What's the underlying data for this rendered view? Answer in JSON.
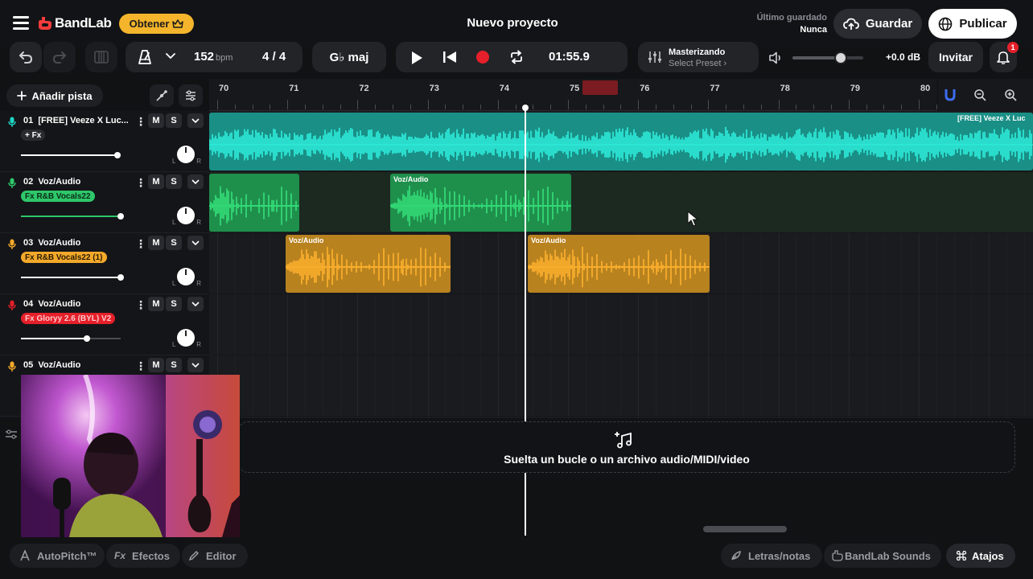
{
  "app": {
    "brand": "BandLab",
    "get_label": "Obtener",
    "project_title": "Nuevo proyecto",
    "last_saved_label": "Último guardado",
    "last_saved_value": "Nunca",
    "save_label": "Guardar",
    "publish_label": "Publicar",
    "accent_color": "#f4b52c"
  },
  "transport": {
    "bpm": "152",
    "bpm_unit": "bpm",
    "time_signature": "4 / 4",
    "key": "G♭ maj",
    "time": "01:55.9",
    "mastering_title": "Masterizando",
    "mastering_preset": "Select Preset ›",
    "master_volume_fraction": 0.68,
    "master_db": "+0.0 dB",
    "invite_label": "Invitar",
    "notification_count": "1"
  },
  "toolbar": {
    "add_track_label": "Añadir pista"
  },
  "ruler": {
    "bars": [
      "70",
      "71",
      "72",
      "73",
      "74",
      "75",
      "76",
      "77",
      "78",
      "79",
      "80"
    ]
  },
  "tracks": [
    {
      "number": "01",
      "name": "[FREE] Veeze X Luc...",
      "fx": "+ Fx",
      "color": "#1ed7c4",
      "volume": 0.97,
      "fx_bg": "#2a2b30",
      "fx_fg": "#ffffff"
    },
    {
      "number": "02",
      "name": "Voz/Audio",
      "fx": "Fx R&B Vocals22",
      "color": "#2ec76a",
      "volume": 1.0,
      "fx_bg": "#2ec76a",
      "fx_fg": "#0c2a17"
    },
    {
      "number": "03",
      "name": "Voz/Audio",
      "fx": "Fx R&B Vocals22 (1)",
      "color": "#f3a92a",
      "volume": 1.0,
      "fx_bg": "#f3a92a",
      "fx_fg": "#2a1c05"
    },
    {
      "number": "04",
      "name": "Voz/Audio",
      "fx": "Fx Gloryy 2.6 (BYL) V2",
      "color": "#e5202a",
      "volume": 0.66,
      "fx_bg": "#e5202a",
      "fx_fg": "#ffc9cc"
    },
    {
      "number": "05",
      "name": "Voz/Audio",
      "fx": "",
      "color": "#f3a92a",
      "volume": 0.0,
      "fx_bg": "#2a2b30",
      "fx_fg": "#ffffff"
    }
  ],
  "track_buttons": {
    "mute": "M",
    "solo": "S"
  },
  "clips": {
    "track1_name": "[FREE] Veeze X Luc",
    "vocal_name": "Voz/Audio"
  },
  "dropzone": {
    "text": "Suelta un bucle o un archivo audio/MIDI/video"
  },
  "bottom": {
    "autopitch": "AutoPitch™",
    "effects": "Efectos",
    "editor": "Editor",
    "lyrics": "Letras/notas",
    "sounds": "BandLab Sounds",
    "shortcuts": "Atajos"
  }
}
